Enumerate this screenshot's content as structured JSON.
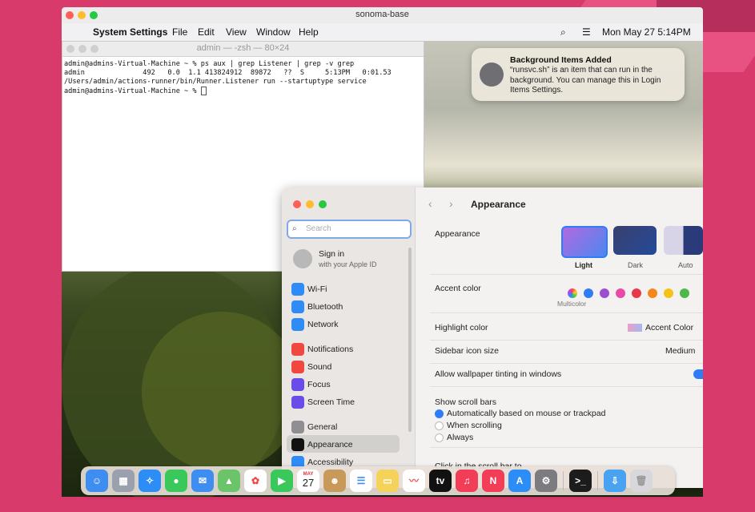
{
  "vm_window": {
    "title": "sonoma-base"
  },
  "menubar": {
    "app": "System Settings",
    "items": [
      "File",
      "Edit",
      "View",
      "Window",
      "Help"
    ],
    "clock": "Mon May 27  5:14PM"
  },
  "terminal": {
    "title": "admin — -zsh — 80×24",
    "lines": [
      "admin@admins-Virtual-Machine ~ % ps aux | grep Listener | grep -v grep",
      "admin              492   0.0  1.1 413824912  89872   ??  S     5:13PM   0:01.53",
      "/Users/admin/actions-runner/bin/Runner.Listener run --startuptype service",
      "admin@admins-Virtual-Machine ~ % "
    ]
  },
  "notification": {
    "title": "Background Items Added",
    "body": "“runsvc.sh” is an item that can run in the background. You can manage this in Login Items Settings."
  },
  "settings": {
    "search_placeholder": "Search",
    "signin_title": "Sign in",
    "signin_sub": "with your Apple ID",
    "sidebar": [
      {
        "label": "Wi-Fi",
        "color": "#2f8cf6",
        "icon": "wifi-icon"
      },
      {
        "label": "Bluetooth",
        "color": "#2f8cf6",
        "icon": "bluetooth-icon"
      },
      {
        "label": "Network",
        "color": "#2f8cf6",
        "icon": "globe-icon"
      },
      {
        "label": "Notifications",
        "color": "#f0483e",
        "icon": "bell-icon"
      },
      {
        "label": "Sound",
        "color": "#f0483e",
        "icon": "speaker-icon"
      },
      {
        "label": "Focus",
        "color": "#6a4de8",
        "icon": "moon-icon"
      },
      {
        "label": "Screen Time",
        "color": "#6a4de8",
        "icon": "hourglass-icon"
      },
      {
        "label": "General",
        "color": "#8e8e93",
        "icon": "gear-icon"
      },
      {
        "label": "Appearance",
        "color": "#111111",
        "icon": "appearance-icon"
      },
      {
        "label": "Accessibility",
        "color": "#2f8cf6",
        "icon": "accessibility-icon"
      }
    ],
    "page_title": "Appearance",
    "appearance_label": "Appearance",
    "modes": [
      "Light",
      "Dark",
      "Auto"
    ],
    "accent_label": "Accent color",
    "accent_sub": "Multicolor",
    "accent_colors": [
      "#2f7cf6",
      "#9b4fd0",
      "#e84aa6",
      "#e8394a",
      "#f3861c",
      "#f5c21a",
      "#4cb84a"
    ],
    "highlight_label": "Highlight color",
    "highlight_value": "Accent Color",
    "sidebar_icon_label": "Sidebar icon size",
    "sidebar_icon_value": "Medium",
    "tint_label": "Allow wallpaper tinting in windows",
    "scroll_label": "Show scroll bars",
    "scroll_options": [
      "Automatically based on mouse or trackpad",
      "When scrolling",
      "Always"
    ],
    "click_label": "Click in the scroll bar to"
  },
  "dock": {
    "calendar_month": "MAY",
    "calendar_day": "27"
  }
}
